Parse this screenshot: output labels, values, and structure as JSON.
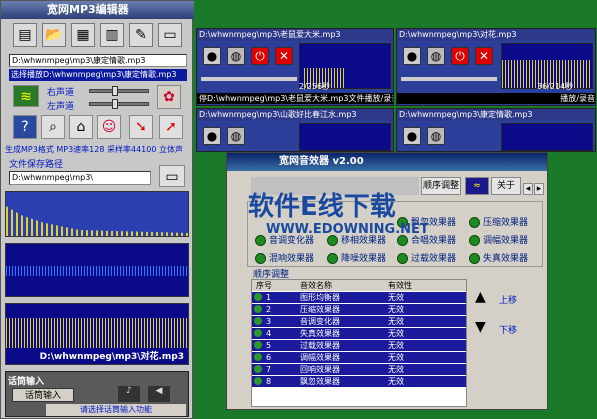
{
  "main": {
    "title": "宽网MP3编辑器",
    "file_select": "D:\\whwnmpeg\\mp3\\康定情歌.mp3",
    "selected_play": "选择播放D:\\whwnmpeg\\mp3\\康定情歌.mp3",
    "right_channel": "右声道",
    "left_channel": "左声道",
    "save_path_label": "文件保存路径",
    "save_path": "D:\\whwnmpeg\\mp3\\",
    "status": "生成MP3格式 MP3速率128 采样率44100 立体声",
    "now_file": "D:\\whwnmpeg\\mp3\\对花.mp3",
    "mic_section": "话筒输入",
    "mic_button": "话筒输入",
    "mic_hint": "请选择话筒输入功能"
  },
  "players": [
    {
      "title": "D:\\whwnmpeg\\mp3\\老鼠爱大米.mp3",
      "time": "2/256秒",
      "status": "停D:\\whwnmpeg\\mp3\\老鼠爱大米.mp3文件播放/录音"
    },
    {
      "title": "D:\\whwnmpeg\\mp3\\对花.mp3",
      "time": "36/214秒",
      "status": "播放/录音"
    },
    {
      "title": "D:\\whwnmpeg\\mp3\\山歌好比春江水.mp3"
    },
    {
      "title": "D:\\whwnmpeg\\mp3\\康定情歌.mp3"
    }
  ],
  "dialog": {
    "title": "宽网音效器 v2.00",
    "tabs": [
      "顺序调整",
      "关于"
    ],
    "effects_rows": [
      [
        "飘忽效果器",
        "压缩效果器"
      ],
      [
        "音调变化器",
        "移相效果器",
        "合唱效果器",
        "调幅效果器"
      ],
      [
        "混响效果器",
        "降噪效果器",
        "过载效果器",
        "失真效果器"
      ]
    ],
    "order_title": "顺序调整",
    "headers": [
      "序号",
      "音效名称",
      "有效性"
    ],
    "rows": [
      [
        "1",
        "图形均衡器",
        "无效"
      ],
      [
        "2",
        "压缩效果器",
        "无效"
      ],
      [
        "3",
        "音调变化器",
        "无效"
      ],
      [
        "4",
        "失真效果器",
        "无效"
      ],
      [
        "5",
        "过载效果器",
        "无效"
      ],
      [
        "6",
        "调幅效果器",
        "无效"
      ],
      [
        "7",
        "回响效果器",
        "无效"
      ],
      [
        "8",
        "飘忽效果器",
        "无效"
      ]
    ],
    "up": "上移",
    "down": "下移"
  },
  "watermark": {
    "main": "软件E线下载",
    "url": "WWW.EDOWNING.NET"
  },
  "colors": {
    "title_blue": "#2c3f78",
    "scope_blue": "#0b0b8a",
    "wave_yellow": "#e0d030",
    "row_blue": "#1a1a9a"
  }
}
